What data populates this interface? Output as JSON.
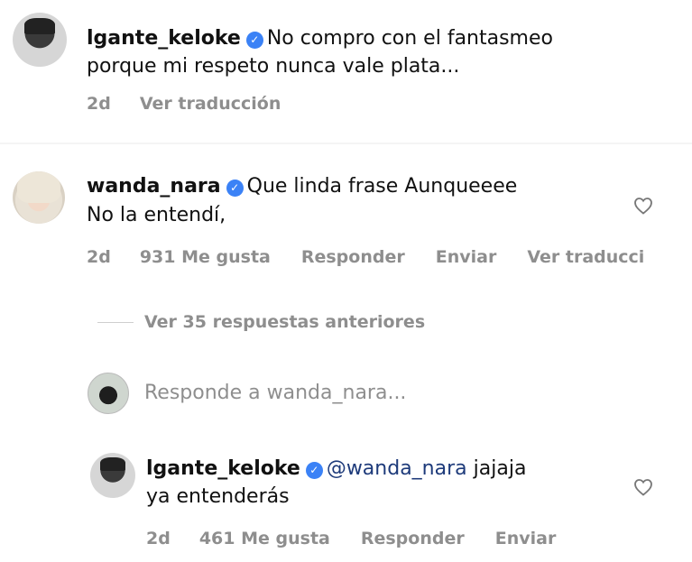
{
  "top_comment": {
    "username": "lgante_keloke",
    "text_line1": "No compro con el fantasmeo",
    "text_line2": "porque mi respeto nunca vale plata...",
    "age": "2d",
    "translate": "Ver traducción"
  },
  "reply_comment": {
    "username": "wanda_nara",
    "text_line1": "Que linda frase Aunqueeee",
    "text_line2": "No la entendí,",
    "age": "2d",
    "likes": "931 Me gusta",
    "reply": "Responder",
    "send": "Enviar",
    "translate": "Ver traducci"
  },
  "thread": {
    "view_previous": "Ver 35 respuestas anteriores",
    "reply_prompt": "Responde a wanda_nara..."
  },
  "nested_reply": {
    "username": "lgante_keloke",
    "mention": "@wanda_nara",
    "text_rest": "jajaja",
    "text_line2": "ya entenderás",
    "age": "2d",
    "likes": "461 Me gusta",
    "reply": "Responder",
    "send": "Enviar"
  },
  "icons": {
    "verified": "verified-badge-icon",
    "like": "heart-icon"
  },
  "colors": {
    "verified": "#3b82f6",
    "meta": "#8e8e8e",
    "mention": "#1d3a7a"
  }
}
